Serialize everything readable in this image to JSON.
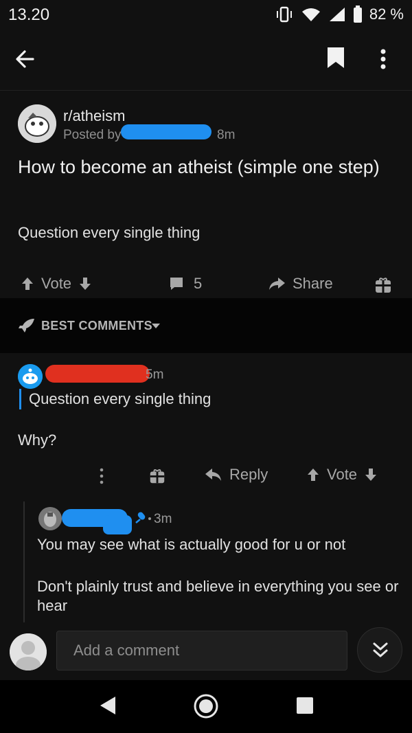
{
  "status_bar": {
    "time": "13.20",
    "battery": "82 %"
  },
  "post": {
    "subreddit": "r/atheism",
    "posted_by_label": "Posted by",
    "age": "8m",
    "title": "How to become an atheist (simple one step)",
    "body": "Question every single thing",
    "vote_label": "Vote",
    "comment_count": "5",
    "share_label": "Share"
  },
  "sort": {
    "label": "BEST COMMENTS"
  },
  "comments": [
    {
      "age": "5m",
      "quote": "Question every single thing",
      "body": "Why?",
      "reply_label": "Reply",
      "vote_label": "Vote"
    },
    {
      "age": "3m",
      "line1": "You may see what is actually good for u or not",
      "line2": "Don't plainly trust and believe in everything you see or hear"
    }
  ],
  "composer": {
    "placeholder": "Add a comment"
  },
  "icons": {
    "back": "arrow-left-icon",
    "bookmark": "bookmark-icon",
    "more": "more-vertical-icon",
    "upvote": "arrow-up-icon",
    "downvote": "arrow-down-icon",
    "comment": "comment-icon",
    "share": "share-icon",
    "award": "gift-icon",
    "sort": "rocket-icon",
    "reply": "reply-icon",
    "jump": "double-chevron-down-icon"
  },
  "colors": {
    "background": "#111111",
    "redaction_blue": "#1f8ff0",
    "redaction_red": "#e0301f",
    "muted_text": "#a8a8a8"
  }
}
